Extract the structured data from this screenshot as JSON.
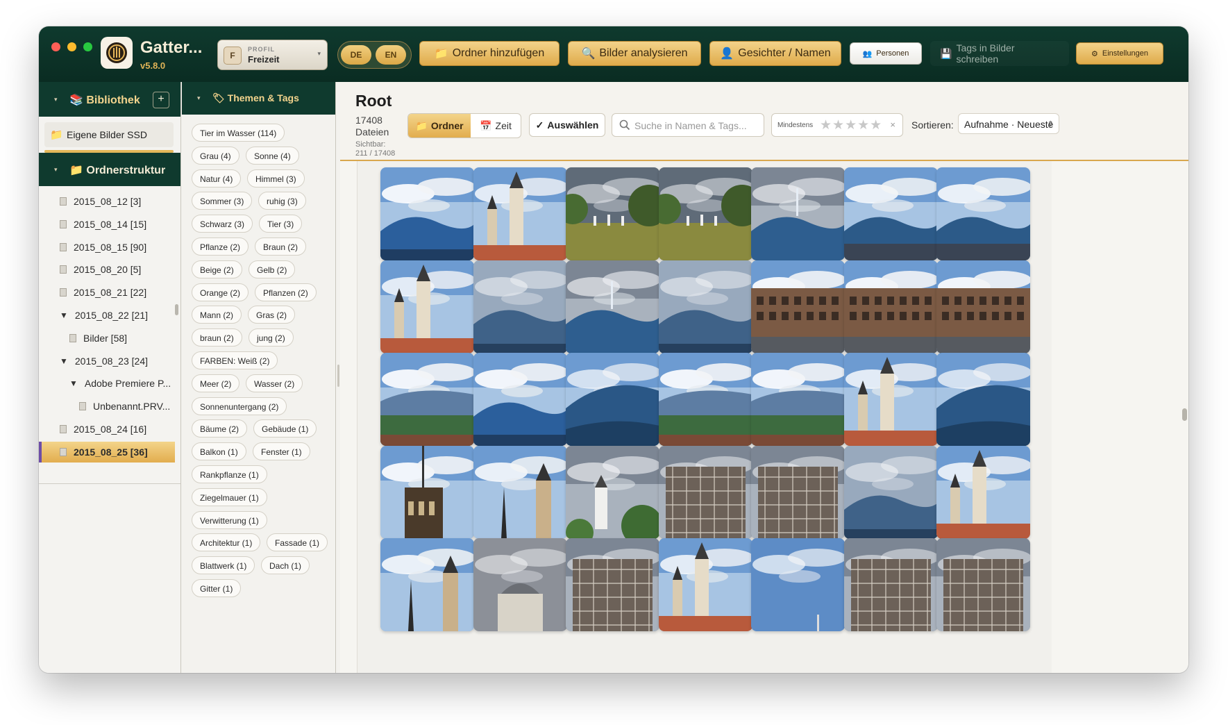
{
  "app": {
    "title": "Gatter...",
    "version": "v5.8.0",
    "logo_icon": "gate-logo-icon"
  },
  "profile": {
    "caption": "PROFIL",
    "badge": "F",
    "name": "Freizeit"
  },
  "languages": [
    "DE",
    "EN"
  ],
  "toolbar": {
    "add_folder": "Ordner hinzufügen",
    "analyze": "Bilder analysieren",
    "faces": "Gesichter / Namen",
    "persons": "Personen",
    "write_tags": "Tags in Bilder schreiben",
    "settings": "Einstellungen"
  },
  "library": {
    "title": "Bibliothek",
    "add": "+",
    "source": "Eigene Bilder SSD",
    "folder_section": "Ordnerstruktur",
    "tree": [
      {
        "label": "2015_08_12 [3]",
        "kind": "leaf",
        "depth": 0
      },
      {
        "label": "2015_08_14 [15]",
        "kind": "leaf",
        "depth": 0
      },
      {
        "label": "2015_08_15 [90]",
        "kind": "leaf",
        "depth": 0
      },
      {
        "label": "2015_08_20 [5]",
        "kind": "leaf",
        "depth": 0
      },
      {
        "label": "2015_08_21 [22]",
        "kind": "leaf",
        "depth": 0
      },
      {
        "label": "2015_08_22 [21]",
        "kind": "open",
        "depth": 0
      },
      {
        "label": "Bilder [58]",
        "kind": "leaf",
        "depth": 1
      },
      {
        "label": "2015_08_23 [24]",
        "kind": "open",
        "depth": 0
      },
      {
        "label": "Adobe Premiere P...",
        "kind": "open",
        "depth": 1
      },
      {
        "label": "Unbenannt.PRV...",
        "kind": "leaf",
        "depth": 2
      },
      {
        "label": "2015_08_24 [16]",
        "kind": "leaf",
        "depth": 0
      },
      {
        "label": "2015_08_25 [36]",
        "kind": "leaf",
        "depth": 0,
        "active": true
      }
    ]
  },
  "tags_panel": {
    "title": "Themen & Tags",
    "tags": [
      [
        "Tier im Wasser (114)"
      ],
      [
        "Grau (4)",
        "Sonne (4)"
      ],
      [
        "Natur (4)",
        "Himmel (3)"
      ],
      [
        "Sommer (3)",
        "ruhig (3)"
      ],
      [
        "Schwarz (3)",
        "Tier (3)"
      ],
      [
        "Pflanze (2)",
        "Braun (2)"
      ],
      [
        "Beige (2)",
        "Gelb (2)"
      ],
      [
        "Orange (2)",
        "Pflanzen (2)"
      ],
      [
        "Mann (2)",
        "Gras (2)"
      ],
      [
        "braun (2)",
        "jung (2)"
      ],
      [
        "FARBEN: Weiß (2)"
      ],
      [
        "Meer (2)",
        "Wasser (2)"
      ],
      [
        "Sonnenuntergang (2)"
      ],
      [
        "Bäume (2)",
        "Gebäude (1)"
      ],
      [
        "Balkon (1)",
        "Fenster (1)"
      ],
      [
        "Rankpflanze (1)"
      ],
      [
        "Ziegelmauer (1)"
      ],
      [
        "Verwitterung (1)"
      ],
      [
        "Architektur (1)",
        "Fassade (1)"
      ],
      [
        "Blattwerk (1)",
        "Dach (1)"
      ],
      [
        "Gitter (1)"
      ]
    ]
  },
  "main": {
    "title": "Root",
    "file_count": "17408 Dateien",
    "visible_label": "Sichtbar:",
    "visible_value": "211 / 17408",
    "view_folder": "Ordner",
    "view_time": "Zeit",
    "select": "Auswählen",
    "search_placeholder": "Suche in Namen & Tags...",
    "min_rating_label": "Mindestens",
    "rating_stars": "★★★★★",
    "rating_value": 0,
    "rating_clear": "×",
    "sort_label": "Sortieren:",
    "sort_value": "Aufnahme · Neueste"
  },
  "thumbnails": [
    "mountain",
    "church-tower",
    "field-trees",
    "field-trees",
    "mountain-tower",
    "mountain-town",
    "mountain-town",
    "church-tower",
    "mountain-hazy",
    "mountain-tower",
    "mountain-hazy",
    "school-building",
    "school-building",
    "school-building",
    "hills-forest",
    "mountain",
    "hills-dark",
    "hills-forest",
    "hills-forest",
    "church-tower",
    "hills-dark",
    "tower-close",
    "twin-towers",
    "white-tower",
    "scaffold",
    "scaffold",
    "mountain-hazy",
    "church-tower",
    "twin-towers",
    "dome-building",
    "scaffold",
    "church-tower",
    "sky-blue",
    "scaffold",
    "scaffold"
  ]
}
